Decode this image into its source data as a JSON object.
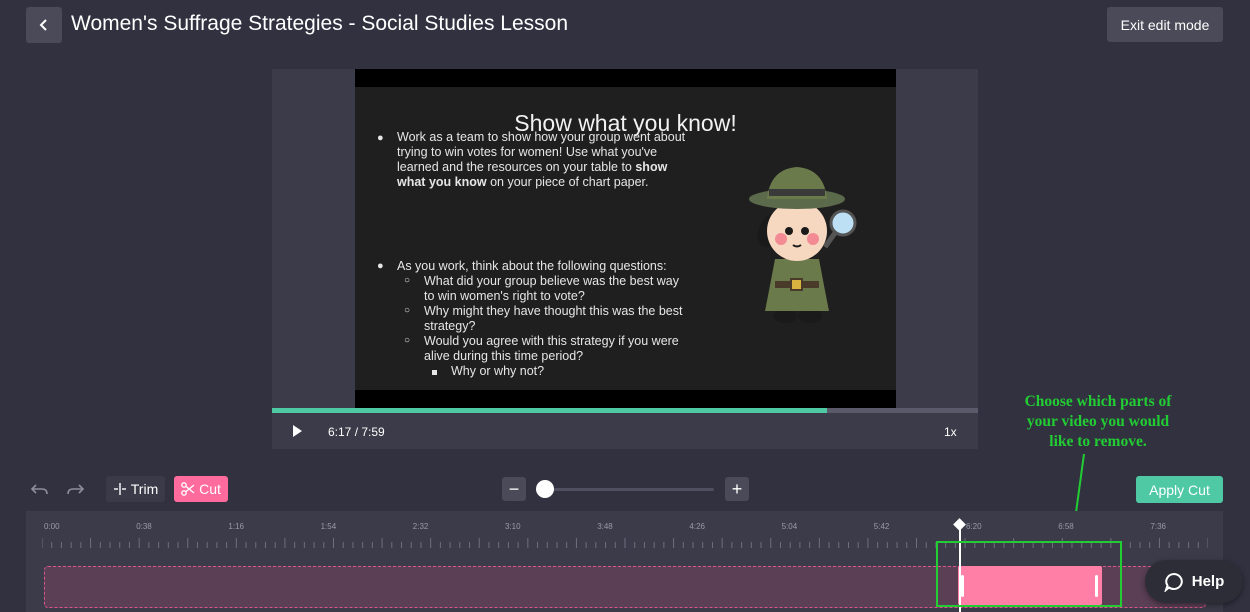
{
  "header": {
    "title": "Women's Suffrage Strategies - Social Studies Lesson",
    "exit_label": "Exit edit mode"
  },
  "slide": {
    "title": "Show what you know!",
    "bullet1_lines": [
      "Work as a team to show how your group went about",
      "trying to win votes for women! Use what you've",
      "learned and the resources on your table to ",
      "what you know"
    ],
    "bullet1_bold1": "show",
    "bullet1_tail": " on your piece of chart paper.",
    "bullet2": "As you work, think about the following questions:",
    "sub1_l1": "What did your group believe was the best way",
    "sub1_l2": "to win women's right to vote?",
    "sub2_l1": "Why might they have thought this was the best",
    "sub2_l2": "strategy?",
    "sub3_l1": "Would you agree with this strategy if you were",
    "sub3_l2": "alive during this time period?",
    "subsub1": "Why or why not?"
  },
  "player": {
    "time": "6:17 / 7:59",
    "speed": "1x",
    "progress": 0.786
  },
  "annotation": {
    "lines": [
      "Choose which parts of",
      "your video you would",
      "like to remove."
    ],
    "color": "#22cc33"
  },
  "toolbar": {
    "trim_label": "Trim",
    "cut_label": "Cut",
    "apply_label": "Apply Cut"
  },
  "timeline": {
    "ticks": [
      "0:00",
      "0:38",
      "1:16",
      "1:54",
      "2:32",
      "3:10",
      "3:48",
      "4:26",
      "5:04",
      "5:42",
      "6:20",
      "6:58",
      "7:36"
    ],
    "playhead_time": "6:17",
    "cut_start": "6:17",
    "cut_end": "7:12"
  },
  "help": {
    "label": "Help"
  },
  "colors": {
    "accent_green": "#4ec9a4",
    "cut_pink": "#ff6b9c",
    "background": "#313140"
  }
}
